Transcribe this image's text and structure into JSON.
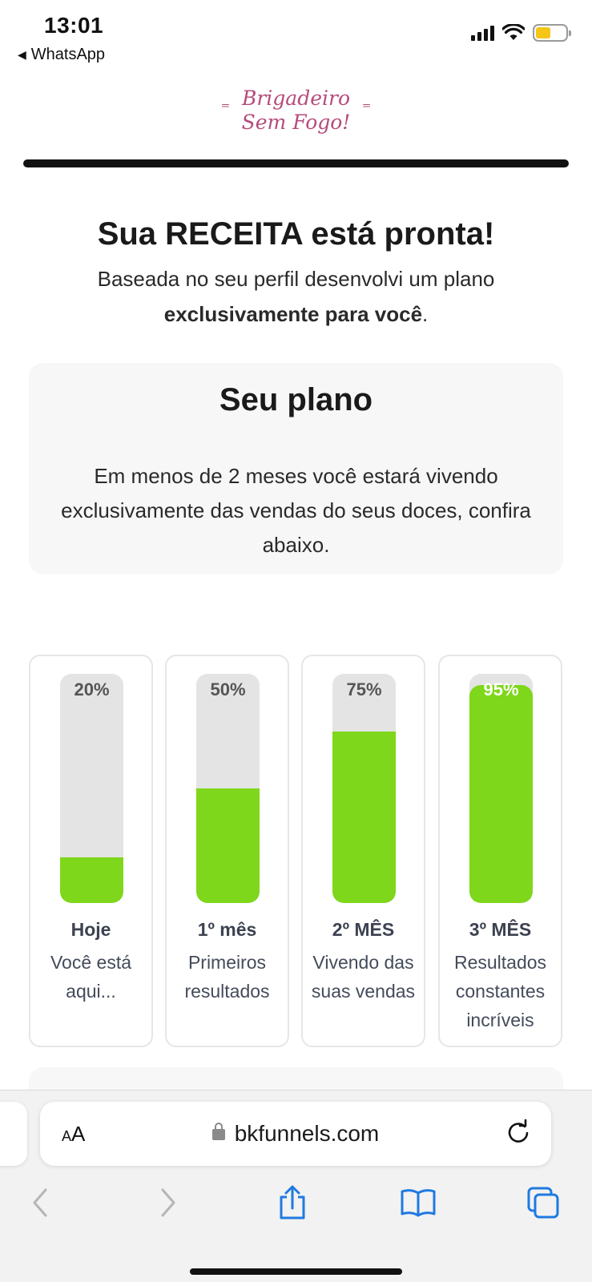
{
  "status_bar": {
    "time": "13:01",
    "back_app": "WhatsApp",
    "back_icon": "back-triangle-icon",
    "icons": [
      "cellular-signal-icon",
      "wifi-icon",
      "battery-icon"
    ],
    "battery_color": "#f5c518"
  },
  "logo": {
    "line1": "Brigadeiro",
    "line2": "Sem Fogo!",
    "color": "#b54b7b"
  },
  "header": {
    "title": "Sua RECEITA está pronta!",
    "subtitle_plain": "Baseada no seu perfil desenvolvi um plano",
    "subtitle_bold": "exclusivamente para você",
    "subtitle_end": "."
  },
  "plan": {
    "title": "Seu plano",
    "text": "Em menos de 2 meses você estará vivendo exclusivamente das vendas do seus doces, confira abaixo."
  },
  "progress_bars": [
    {
      "percent_label": "20%",
      "level": 0.2,
      "label": "Hoje",
      "description": "Você está aqui..."
    },
    {
      "percent_label": "50%",
      "level": 0.5,
      "label": "1º mês",
      "description": "Primeiros resultados"
    },
    {
      "percent_label": "75%",
      "level": 0.75,
      "label": "2º MÊS",
      "description": "Vivendo das suas vendas"
    },
    {
      "percent_label": "95%",
      "level": 0.95,
      "label": "3º MÊS",
      "description": "Resultados constantes incríveis"
    }
  ],
  "colors": {
    "bar_fill": "#7ed71a",
    "bar_track": "#e4e4e4"
  },
  "browser": {
    "aa_label": "AA",
    "url": "bkfunnels.com",
    "icons": [
      "lock-icon",
      "reload-icon",
      "back-arrow-icon",
      "forward-arrow-icon",
      "share-icon",
      "bookmarks-icon",
      "tabs-icon"
    ]
  }
}
